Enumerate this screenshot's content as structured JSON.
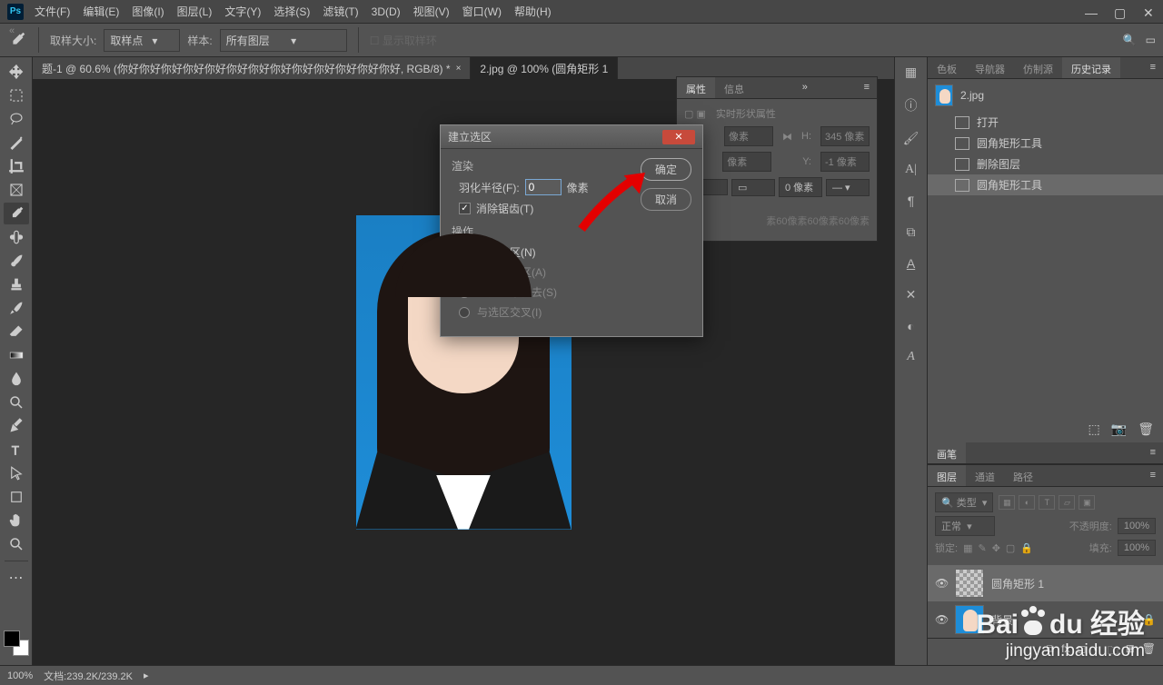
{
  "menu": [
    "文件(F)",
    "编辑(E)",
    "图像(I)",
    "图层(L)",
    "文字(Y)",
    "选择(S)",
    "滤镜(T)",
    "3D(D)",
    "视图(V)",
    "窗口(W)",
    "帮助(H)"
  ],
  "options": {
    "sample_size_label": "取样大小:",
    "sample_size_value": "取样点",
    "sample_label": "样本:",
    "sample_value": "所有图层",
    "show_ring": "显示取样环"
  },
  "tabs": [
    "题-1 @ 60.6% (你好你好你好你好你好你好你好你好你好你好你好你好你好, RGB/8) *",
    "2.jpg @ 100% (圆角矩形 1"
  ],
  "dialog": {
    "title": "建立选区",
    "render_group": "渲染",
    "feather_label": "羽化半径(F):",
    "feather_value": "0",
    "feather_unit": "像素",
    "antialias": "消除锯齿(T)",
    "op_group": "操作",
    "ops": [
      "新建选区(N)",
      "添加到选区(A)",
      "从选区中减去(S)",
      "与选区交叉(I)"
    ],
    "ok": "确定",
    "cancel": "取消"
  },
  "props": {
    "tab1": "属性",
    "tab2": "信息",
    "title": "实时形状属性",
    "h_label": "H:",
    "h_value": "345 像素",
    "y_label": "Y:",
    "y_value": "-1 像素",
    "unit": "0 像素",
    "corners": "素60像素60像素60像素"
  },
  "right_tabs": [
    "色板",
    "导航器",
    "仿制源",
    "历史记录"
  ],
  "history": {
    "doc": "2.jpg",
    "items": [
      "打开",
      "圆角矩形工具",
      "删除图层",
      "圆角矩形工具"
    ]
  },
  "brush_tab": "画笔",
  "layer_tabs": [
    "图层",
    "通道",
    "路径"
  ],
  "layers": {
    "type_label": "类型",
    "search_icon": "🔍",
    "blend": "正常",
    "opacity_label": "不透明度:",
    "opacity_value": "100%",
    "lock_label": "锁定:",
    "fill_label": "填充:",
    "fill_value": "100%",
    "items": [
      {
        "name": "圆角矩形 1"
      },
      {
        "name": "背景"
      }
    ]
  },
  "status": {
    "zoom": "100%",
    "doc_label": "文档:",
    "doc_value": "239.2K/239.2K"
  },
  "watermark": {
    "brand": "Baidu 经验",
    "sub": "jingyan.baidu.com"
  }
}
